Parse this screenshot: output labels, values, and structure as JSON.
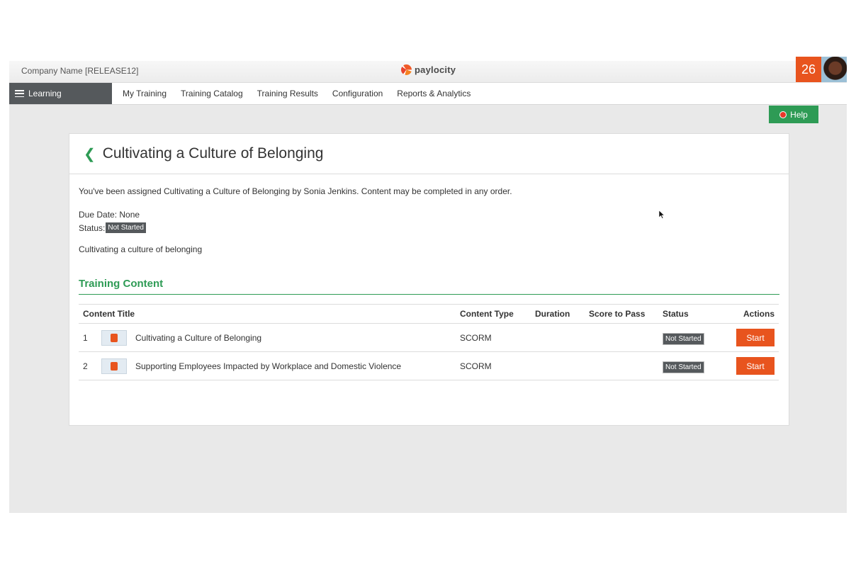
{
  "header": {
    "company": "Company Name [RELEASE12]",
    "brand": "paylocity",
    "notification_count": "26"
  },
  "nav": {
    "menu_label": "Learning",
    "links": [
      "My Training",
      "Training Catalog",
      "Training Results",
      "Configuration",
      "Reports & Analytics"
    ]
  },
  "help_label": "Help",
  "page": {
    "title": "Cultivating a Culture of Belonging",
    "assignment_text": "You've been assigned Cultivating a Culture of Belonging by Sonia Jenkins. Content may be completed in any order.",
    "due_date": "Due Date: None",
    "status_label": "Status:",
    "status_value": "Not Started",
    "description": "Cultivating a culture of belonging",
    "section_title": "Training Content"
  },
  "table": {
    "headers": [
      "Content Title",
      "Content Type",
      "Duration",
      "Score to Pass",
      "Status",
      "Actions"
    ],
    "rows": [
      {
        "num": "1",
        "title": "Cultivating a Culture of Belonging",
        "type": "SCORM",
        "duration": "",
        "score": "",
        "status": "Not Started",
        "action": "Start"
      },
      {
        "num": "2",
        "title": "Supporting Employees Impacted by Workplace and Domestic Violence",
        "type": "SCORM",
        "duration": "",
        "score": "",
        "status": "Not Started",
        "action": "Start"
      }
    ]
  },
  "colors": {
    "accent": "#2e9b55",
    "action": "#e8541e",
    "badge": "#55595c"
  }
}
